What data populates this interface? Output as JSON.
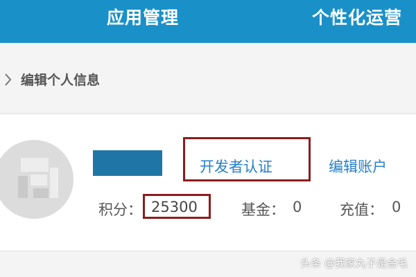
{
  "nav": {
    "tabs": [
      {
        "label": "应用管理"
      },
      {
        "label": "个性化运营"
      }
    ],
    "accent_color": "#1a90c8"
  },
  "section": {
    "title": "编辑个人信息",
    "chevron_icon": "chevron-right-icon"
  },
  "profile": {
    "avatar_icon": "avatar-placeholder-icon",
    "username_redacted": true,
    "developer_cert_label": "开发者认证",
    "edit_account_label": "编辑账户",
    "points_label": "积分：",
    "points_value": "25300",
    "fund_label": "基金：",
    "fund_value": "0",
    "recharge_label": "充值：",
    "recharge_value": "0",
    "highlight_color": "#8b1c1c",
    "link_color": "#2680c8"
  },
  "watermark": {
    "text": "头条 @我家丸子是金毛"
  }
}
